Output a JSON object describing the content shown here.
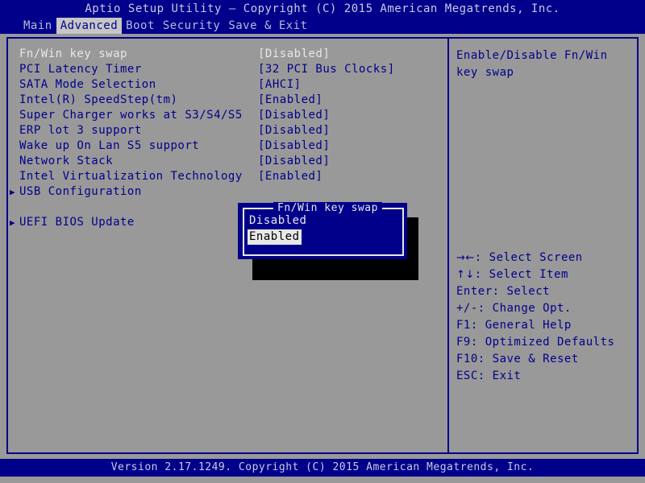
{
  "header": {
    "title": "Aptio Setup Utility – Copyright (C) 2015 American Megatrends, Inc."
  },
  "tabs": [
    {
      "label": "Main",
      "active": false
    },
    {
      "label": "Advanced",
      "active": true
    },
    {
      "label": "Boot",
      "active": false
    },
    {
      "label": "Security",
      "active": false
    },
    {
      "label": "Save & Exit",
      "active": false
    }
  ],
  "settings": [
    {
      "label": "Fn/Win key swap",
      "value": "[Disabled]",
      "arrow": "",
      "current": true
    },
    {
      "label": "PCI Latency Timer",
      "value": "[32 PCI Bus Clocks]",
      "arrow": "",
      "current": false
    },
    {
      "label": "SATA Mode Selection",
      "value": "[AHCI]",
      "arrow": "",
      "current": false
    },
    {
      "label": "Intel(R) SpeedStep(tm)",
      "value": "[Enabled]",
      "arrow": "",
      "current": false
    },
    {
      "label": "Super Charger works at S3/S4/S5",
      "value": "[Disabled]",
      "arrow": "",
      "current": false
    },
    {
      "label": "ERP lot 3 support",
      "value": "[Disabled]",
      "arrow": "",
      "current": false
    },
    {
      "label": "Wake up On Lan S5 support",
      "value": "[Disabled]",
      "arrow": "",
      "current": false
    },
    {
      "label": "Network Stack",
      "value": "[Disabled]",
      "arrow": "",
      "current": false
    },
    {
      "label": "Intel Virtualization Technology",
      "value": "[Enabled]",
      "arrow": "",
      "current": false
    },
    {
      "label": "USB Configuration",
      "value": "",
      "arrow": "▶",
      "current": false
    },
    {
      "label": "",
      "value": "",
      "arrow": "",
      "current": false
    },
    {
      "label": "UEFI BIOS Update",
      "value": "",
      "arrow": "▶",
      "current": false
    }
  ],
  "help": {
    "description": "Enable/Disable Fn/Win key swap",
    "nav": [
      {
        "glyph": "→←",
        "text": ": Select Screen"
      },
      {
        "glyph": "↑↓",
        "text": ": Select Item"
      },
      {
        "glyph": "",
        "text": "Enter: Select"
      },
      {
        "glyph": "",
        "text": "+/-: Change Opt."
      },
      {
        "glyph": "",
        "text": "F1: General Help"
      },
      {
        "glyph": "",
        "text": "F9: Optimized Defaults"
      },
      {
        "glyph": "",
        "text": "F10: Save & Reset"
      },
      {
        "glyph": "",
        "text": "ESC: Exit"
      }
    ]
  },
  "popup": {
    "title": "Fn/Win key swap",
    "options": [
      {
        "label": "Disabled",
        "selected": false
      },
      {
        "label": "Enabled",
        "selected": true
      }
    ]
  },
  "footer": {
    "version": "Version 2.17.1249. Copyright (C) 2015 American Megatrends, Inc."
  },
  "colors": {
    "background": "#999999",
    "accent_blue": "#00008b",
    "text_light": "#c9c9e0",
    "highlight_bg": "#e8e8e8",
    "tab_active_bg": "#c6c6c6"
  }
}
